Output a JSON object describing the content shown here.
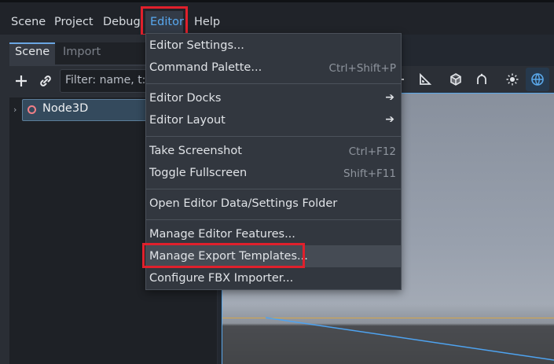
{
  "menubar": {
    "items": [
      "Scene",
      "Project",
      "Debug",
      "Editor",
      "Help"
    ]
  },
  "dock": {
    "tabs": [
      "Scene",
      "Import"
    ],
    "filter_placeholder": "Filter: name, t:t",
    "tree": {
      "root_label": "Node3D"
    }
  },
  "editor_menu": {
    "items": [
      {
        "label": "Editor Settings...",
        "shortcut": ""
      },
      {
        "label": "Command Palette...",
        "shortcut": "Ctrl+Shift+P"
      },
      {
        "label": "Editor Docks",
        "shortcut": ""
      },
      {
        "label": "Editor Layout",
        "shortcut": ""
      },
      {
        "label": "Take Screenshot",
        "shortcut": "Ctrl+F12"
      },
      {
        "label": "Toggle Fullscreen",
        "shortcut": "Shift+F11"
      },
      {
        "label": "Open Editor Data/Settings Folder",
        "shortcut": ""
      },
      {
        "label": "Manage Editor Features...",
        "shortcut": ""
      },
      {
        "label": "Manage Export Templates...",
        "shortcut": ""
      },
      {
        "label": "Configure FBX Importer...",
        "shortcut": ""
      }
    ]
  },
  "colors": {
    "accent": "#58a8ef",
    "highlight_box": "#e0202c",
    "node_icon": "#f07f87"
  }
}
